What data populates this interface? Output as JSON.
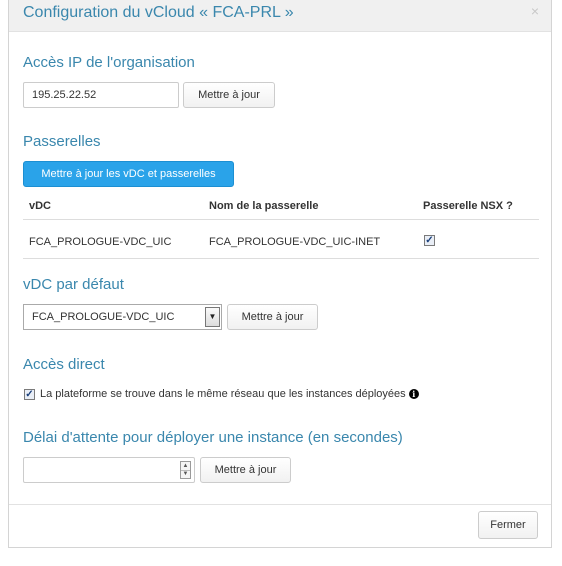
{
  "header": {
    "title": "Configuration du vCloud « FCA-PRL »",
    "close_label": "×"
  },
  "org_ip": {
    "section_title": "Accès IP de l'organisation",
    "value": "195.25.22.52",
    "update_label": "Mettre à jour"
  },
  "gateways": {
    "section_title": "Passerelles",
    "update_label": "Mettre à jour les vDC et passerelles",
    "columns": [
      "vDC",
      "Nom de la passerelle",
      "Passerelle NSX ?"
    ],
    "rows": [
      {
        "vdc": "FCA_PROLOGUE-VDC_UIC",
        "gateway_name": "FCA_PROLOGUE-VDC_UIC-INET",
        "nsx_checked": true
      }
    ]
  },
  "default_vdc": {
    "section_title": "vDC par défaut",
    "selected": "FCA_PROLOGUE-VDC_UIC",
    "update_label": "Mettre à jour"
  },
  "direct_access": {
    "section_title": "Accès direct",
    "checked": true,
    "checkbox_label": "La plateforme se trouve dans le même réseau que les instances déployées",
    "info_icon": "info-icon"
  },
  "timeout": {
    "section_title": "Délai d'attente pour déployer une instance (en secondes)",
    "value": "",
    "update_label": "Mettre à jour"
  },
  "footer": {
    "close_label": "Fermer"
  },
  "colors": {
    "accent": "#3a87ad",
    "primary_button": "#2aa3e9",
    "header_bg": "#f0f0f0"
  }
}
